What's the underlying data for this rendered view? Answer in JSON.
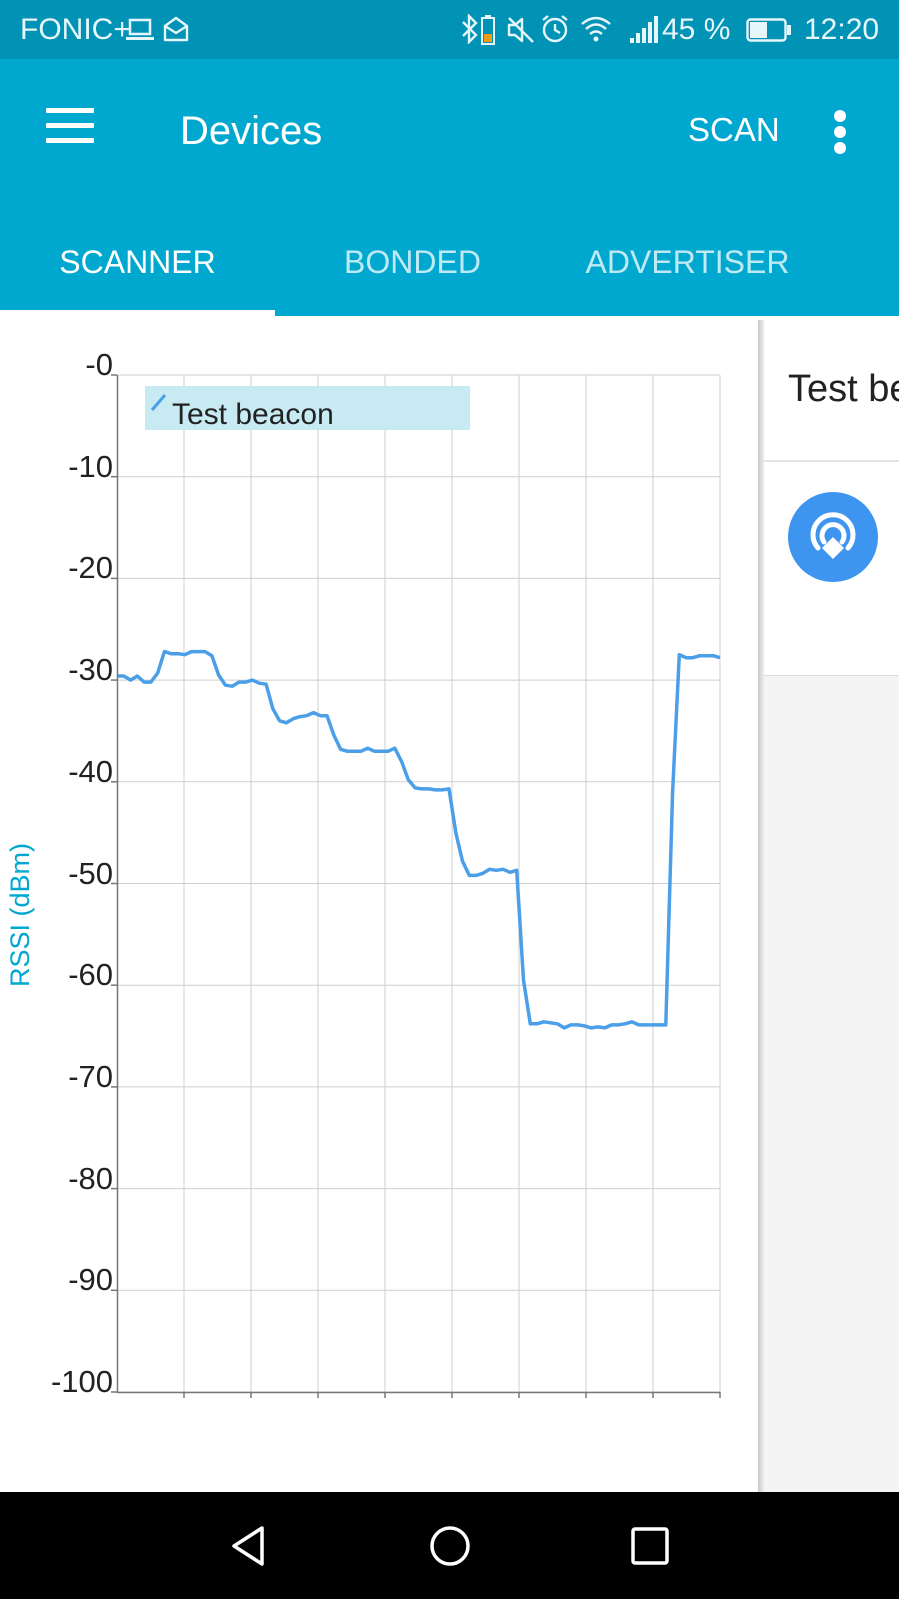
{
  "status_bar": {
    "carrier": "FONIC+",
    "battery_percent": "45 %",
    "time": "12:20",
    "icons": [
      "laptop-icon",
      "mail-icon",
      "bluetooth-icon",
      "mute-icon",
      "alarm-icon",
      "wifi-icon",
      "signal-icon",
      "battery-icon"
    ]
  },
  "app_bar": {
    "title": "Devices",
    "scan_label": "SCAN",
    "menu_icon": "hamburger-menu-icon",
    "overflow_icon": "more-vert-icon"
  },
  "tabs": [
    {
      "label": "SCANNER",
      "active": true
    },
    {
      "label": "BONDED",
      "active": false
    },
    {
      "label": "ADVERTISER",
      "active": false
    }
  ],
  "colors": {
    "status_bar": "#0093b6",
    "app_bar": "#00a8d0",
    "tab_active_text": "#ffffff",
    "tab_inactive_text": "#bfe9f3",
    "series_line": "#4a9fe8",
    "legend_bg": "#c8ebf3",
    "axis_title": "#00a8d0"
  },
  "chart_data": {
    "type": "line",
    "ylabel": "RSSI (dBm)",
    "ylim": [
      -100,
      0
    ],
    "y_ticks": [
      "-0",
      "-10",
      "-20",
      "-30",
      "-40",
      "-50",
      "-60",
      "-70",
      "-80",
      "-90",
      "-100"
    ],
    "grid": true,
    "legend_placement": "top-left",
    "series": [
      {
        "name": "Test beacon",
        "x": [
          0,
          1,
          2,
          3,
          4,
          5,
          6,
          7,
          8,
          9,
          10,
          11,
          12,
          13,
          14,
          15,
          16,
          17,
          18,
          19,
          20,
          21,
          22,
          23,
          24,
          25,
          26,
          27,
          28,
          29,
          30,
          31,
          32,
          33,
          34,
          35,
          36,
          37,
          38,
          39,
          40,
          41,
          42,
          43,
          44,
          45,
          46,
          47,
          48,
          49,
          50,
          51,
          52,
          53,
          54,
          55,
          56,
          57,
          58,
          59,
          60,
          61,
          62,
          63,
          64,
          65,
          66,
          67,
          68,
          69,
          70,
          71,
          72,
          73,
          74,
          75,
          76,
          77,
          78,
          79,
          80,
          81,
          82,
          83,
          84,
          85,
          86,
          87,
          88,
          89
        ],
        "values": [
          -29.6,
          -29.6,
          -30.0,
          -29.6,
          -30.2,
          -30.2,
          -29.3,
          -27.2,
          -27.4,
          -27.4,
          -27.5,
          -27.2,
          -27.2,
          -27.2,
          -27.6,
          -29.5,
          -30.5,
          -30.6,
          -30.2,
          -30.2,
          -30.0,
          -30.3,
          -30.4,
          -32.8,
          -34.0,
          -34.2,
          -33.8,
          -33.6,
          -33.5,
          -33.2,
          -33.5,
          -33.5,
          -35.4,
          -36.8,
          -37.0,
          -37.0,
          -37.0,
          -36.7,
          -37.0,
          -37.0,
          -37.0,
          -36.7,
          -38.0,
          -39.8,
          -40.6,
          -40.7,
          -40.7,
          -40.8,
          -40.8,
          -40.7,
          -45.0,
          -47.8,
          -49.2,
          -49.2,
          -49.0,
          -48.6,
          -48.7,
          -48.6,
          -48.9,
          -48.7,
          -59.5,
          -63.8,
          -63.8,
          -63.6,
          -63.7,
          -63.8,
          -64.2,
          -63.9,
          -63.9,
          -64.0,
          -64.2,
          -64.1,
          -64.2,
          -63.9,
          -63.9,
          -63.8,
          -63.6,
          -63.9,
          -63.9,
          -63.9,
          -63.9,
          -63.9,
          -41.0,
          -27.5,
          -27.8,
          -27.8,
          -27.6,
          -27.6,
          -27.6,
          -27.8
        ]
      }
    ]
  },
  "device_card": {
    "name": "Test be",
    "icon": "beacon-icon"
  },
  "nav_bar": {
    "back_icon": "back-triangle-icon",
    "home_icon": "home-circle-icon",
    "recents_icon": "recents-square-icon"
  }
}
